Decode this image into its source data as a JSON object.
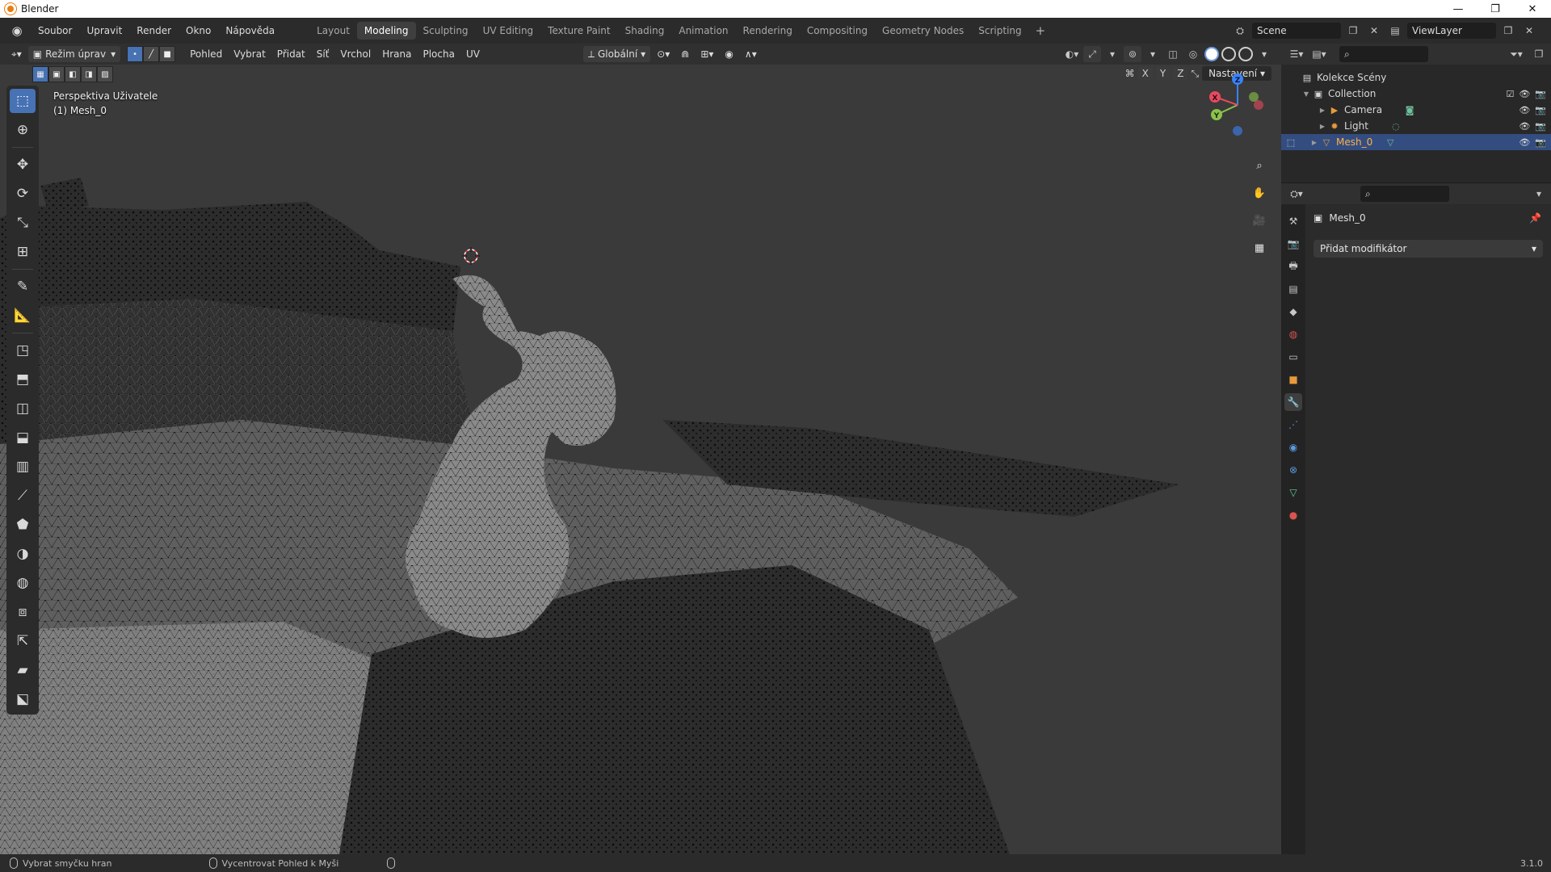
{
  "window": {
    "title": "Blender",
    "controls": [
      "—",
      "❐",
      "✕"
    ]
  },
  "menu": [
    "Soubor",
    "Upravit",
    "Render",
    "Okno",
    "Nápověda"
  ],
  "workspaces": [
    "Layout",
    "Modeling",
    "Sculpting",
    "UV Editing",
    "Texture Paint",
    "Shading",
    "Animation",
    "Rendering",
    "Compositing",
    "Geometry Nodes",
    "Scripting"
  ],
  "active_workspace": "Modeling",
  "scene": {
    "name": "Scene",
    "view_layer": "ViewLayer"
  },
  "viewport_header": {
    "mode": "Režim úprav",
    "menus": [
      "Pohled",
      "Vybrat",
      "Přidat",
      "Síť",
      "Vrchol",
      "Hrana",
      "Plocha",
      "UV"
    ],
    "orientation": "Globální"
  },
  "viewport": {
    "perspective": "Perspektiva Uživatele",
    "object_label": "(1) Mesh_0",
    "mirror_axes": [
      "X",
      "Y",
      "Z"
    ],
    "options_label": "Nastavení",
    "colors": {
      "background": "#3a3a3a",
      "mesh": "#9a9a9a",
      "accent": "#4772b3"
    }
  },
  "gizmo": {
    "axes": [
      "X",
      "Y",
      "Z"
    ],
    "colors": {
      "x": "#e84a5f",
      "y": "#8bc34a",
      "z": "#3b82f6"
    }
  },
  "tools": [
    "select-box",
    "cursor",
    "move",
    "rotate",
    "scale",
    "transform",
    "annotate",
    "measure",
    "add-cube",
    "extrude",
    "inset",
    "bevel",
    "loop-cut",
    "knife",
    "poly-build",
    "spin",
    "smooth",
    "edge-slide",
    "shrink-fatten",
    "shear",
    "rip"
  ],
  "outliner": {
    "root": "Kolekce Scény",
    "collection": "Collection",
    "items": [
      {
        "name": "Camera",
        "type": "camera"
      },
      {
        "name": "Light",
        "type": "light"
      },
      {
        "name": "Mesh_0",
        "type": "mesh",
        "selected": true
      }
    ]
  },
  "properties": {
    "object_name": "Mesh_0",
    "add_modifier_label": "Přidat modifikátor"
  },
  "status": {
    "hints": [
      "Vybrat smyčku hran",
      "Vycentrovat Pohled k Myši"
    ],
    "version": "3.1.0"
  }
}
